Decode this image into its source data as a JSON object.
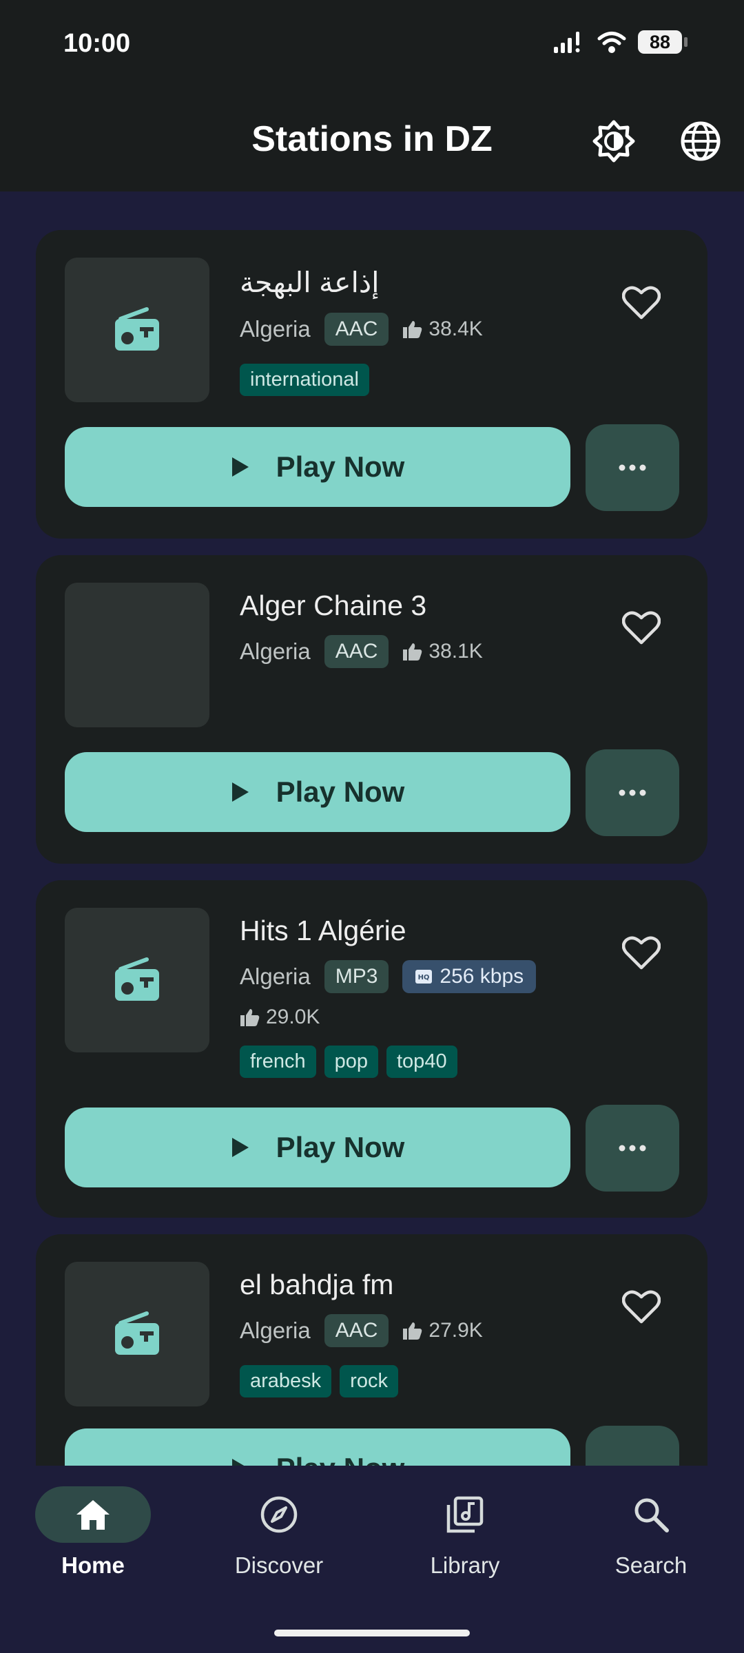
{
  "status_bar": {
    "time": "10:00",
    "battery": "88"
  },
  "header": {
    "title": "Stations in DZ",
    "brightness_icon": "brightness-icon",
    "globe_icon": "globe-icon"
  },
  "colors": {
    "accent": "#82d4c9",
    "background": "#1d1d3a",
    "card": "#1b1f1f",
    "tag": "#00564d",
    "codec": "#314a45",
    "bitrate": "#37506c"
  },
  "stations": [
    {
      "name": "إذاعة البهجة",
      "country": "Algeria",
      "codec": "AAC",
      "likes": "38.4K",
      "tags": [
        "international"
      ],
      "play_label": "Play Now"
    },
    {
      "name": "Alger Chaine 3",
      "country": "Algeria",
      "codec": "AAC",
      "likes": "38.1K",
      "tags": [],
      "play_label": "Play Now"
    },
    {
      "name": "Hits 1 Algérie",
      "country": "Algeria",
      "codec": "MP3",
      "bitrate": "256 kbps",
      "likes": "29.0K",
      "tags": [
        "french",
        "pop",
        "top40"
      ],
      "play_label": "Play Now"
    },
    {
      "name": "el bahdja fm",
      "country": "Algeria",
      "codec": "AAC",
      "likes": "27.9K",
      "tags": [
        "arabesk",
        "rock"
      ],
      "play_label": "Play Now"
    }
  ],
  "nav": {
    "items": [
      {
        "label": "Home",
        "icon": "home-icon"
      },
      {
        "label": "Discover",
        "icon": "compass-icon"
      },
      {
        "label": "Library",
        "icon": "library-icon"
      },
      {
        "label": "Search",
        "icon": "search-icon"
      }
    ]
  }
}
